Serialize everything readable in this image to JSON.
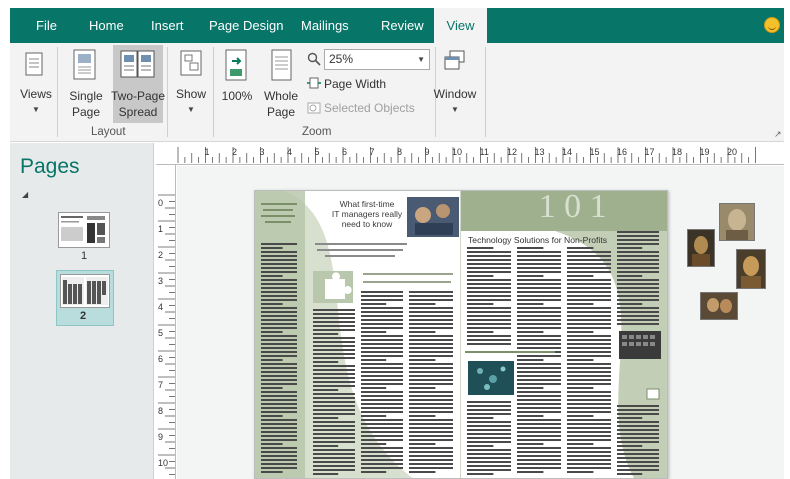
{
  "ribbon_tabs": [
    "File",
    "Home",
    "Insert",
    "Page Design",
    "Mailings",
    "Review",
    "View"
  ],
  "ribbon": {
    "views_label": "Views",
    "single_page_line1": "Single",
    "single_page_line2": "Page",
    "two_page_line1": "Two-Page",
    "two_page_line2": "Spread",
    "show_label": "Show",
    "layout_group": "Layout",
    "zoom_100": "100%",
    "whole_page_line1": "Whole",
    "whole_page_line2": "Page",
    "zoom_value": "25%",
    "page_width": "Page Width",
    "selected_objects": "Selected Objects",
    "zoom_group": "Zoom",
    "window_label": "Window"
  },
  "pane": {
    "title": "Pages",
    "page1_num": "1",
    "page2_num": "2",
    "selected_page": 2
  },
  "ruler": {
    "h_labels": [
      "1",
      "2",
      "3",
      "4",
      "5",
      "6",
      "7",
      "8",
      "9",
      "10",
      "11",
      "12",
      "13",
      "14",
      "15",
      "16",
      "17",
      "18",
      "19",
      "20"
    ],
    "v_labels": [
      "0",
      "1",
      "2",
      "3",
      "4",
      "5",
      "6",
      "7",
      "8",
      "9",
      "10"
    ]
  },
  "doc": {
    "left_headline_l1": "What first-time",
    "left_headline_l2": "IT managers really",
    "left_headline_l3": "need to know",
    "right_header": "Technology Solutions for Non-Profits"
  },
  "colors": {
    "accent": "#077568",
    "tab_text": "#ffffff",
    "doc_green": "#a8b99c"
  },
  "icons": [
    "views-icon",
    "single-page-icon",
    "two-page-spread-icon",
    "show-icon",
    "zoom-100-icon",
    "whole-page-icon",
    "magnifier-icon",
    "page-width-icon",
    "selected-objects-icon",
    "window-icon",
    "smiley-icon"
  ]
}
